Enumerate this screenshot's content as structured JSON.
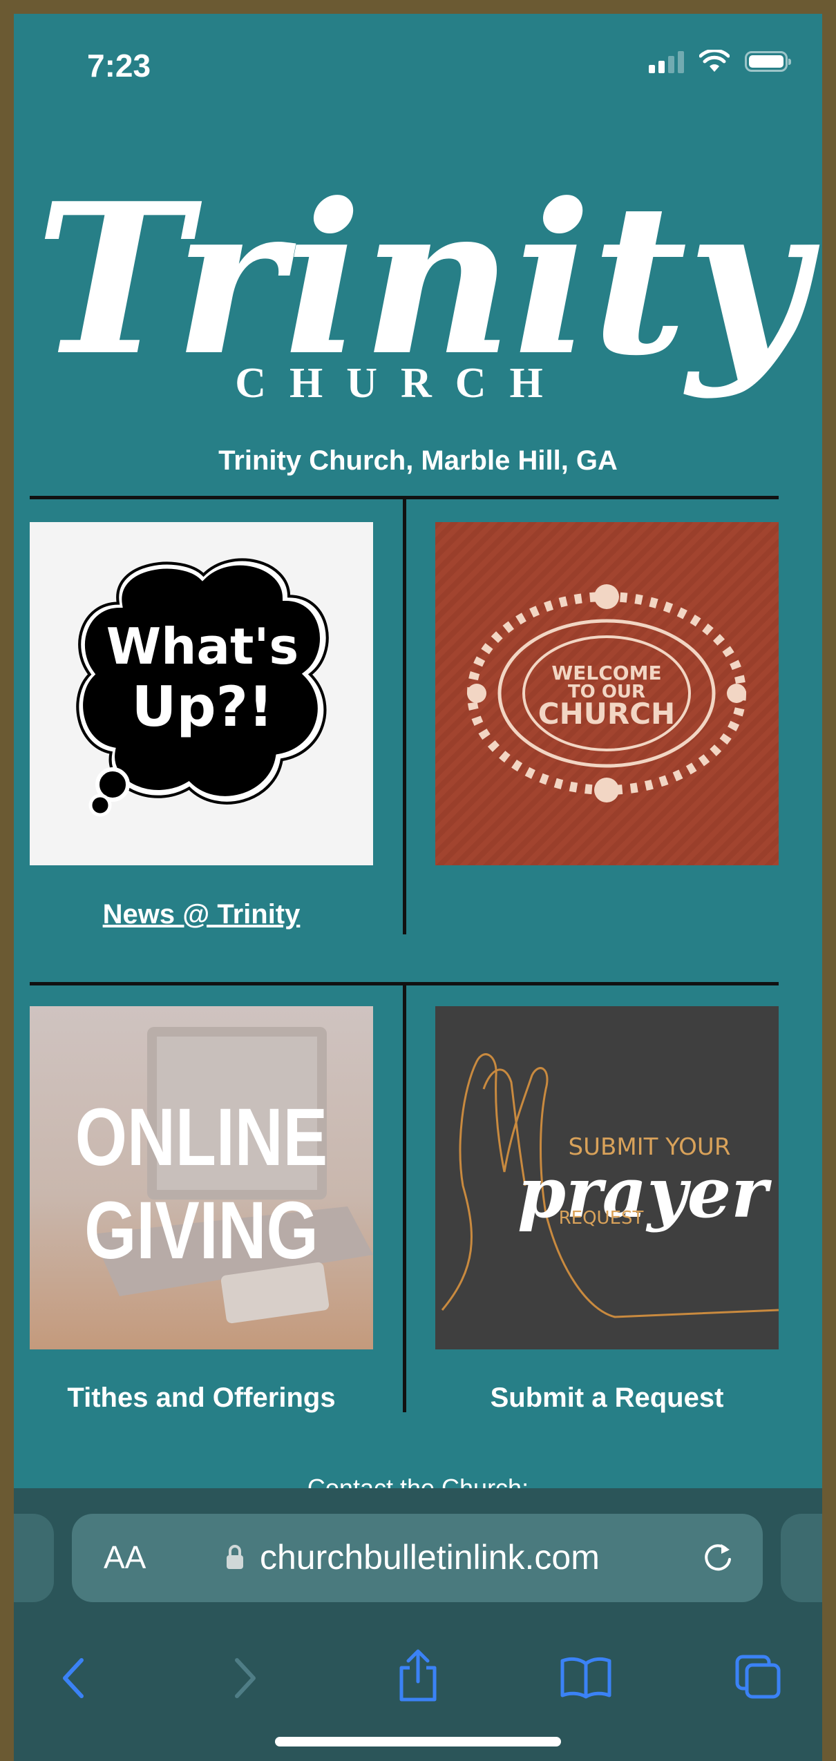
{
  "status_bar": {
    "time": "7:23"
  },
  "logo": {
    "word": "Trinity",
    "sub": "CHURCH"
  },
  "header": {
    "subtitle": "Trinity Church, Marble Hill, GA"
  },
  "tiles": [
    {
      "image_text_1": "What's",
      "image_text_2": "Up?!",
      "caption": "News @ Trinity"
    },
    {
      "image_text_1": "WELCOME",
      "image_text_2": "TO OUR",
      "image_text_3": "CHURCH",
      "caption": ""
    },
    {
      "image_text_1": "ONLINE",
      "image_text_2": "GIVING",
      "caption": "Tithes and Offerings"
    },
    {
      "image_text_1": "SUBMIT YOUR",
      "image_text_2": "prayer",
      "image_text_3": "REQUEST",
      "caption": "Submit a Request"
    }
  ],
  "footer": {
    "contact": "Contact the Church:"
  },
  "browser": {
    "text_size": "AA",
    "url": "churchbulletinlink.com"
  },
  "colors": {
    "page_bg": "#277f87",
    "toolbar_bg": "#2b5559",
    "accent": "#3b82f6"
  }
}
